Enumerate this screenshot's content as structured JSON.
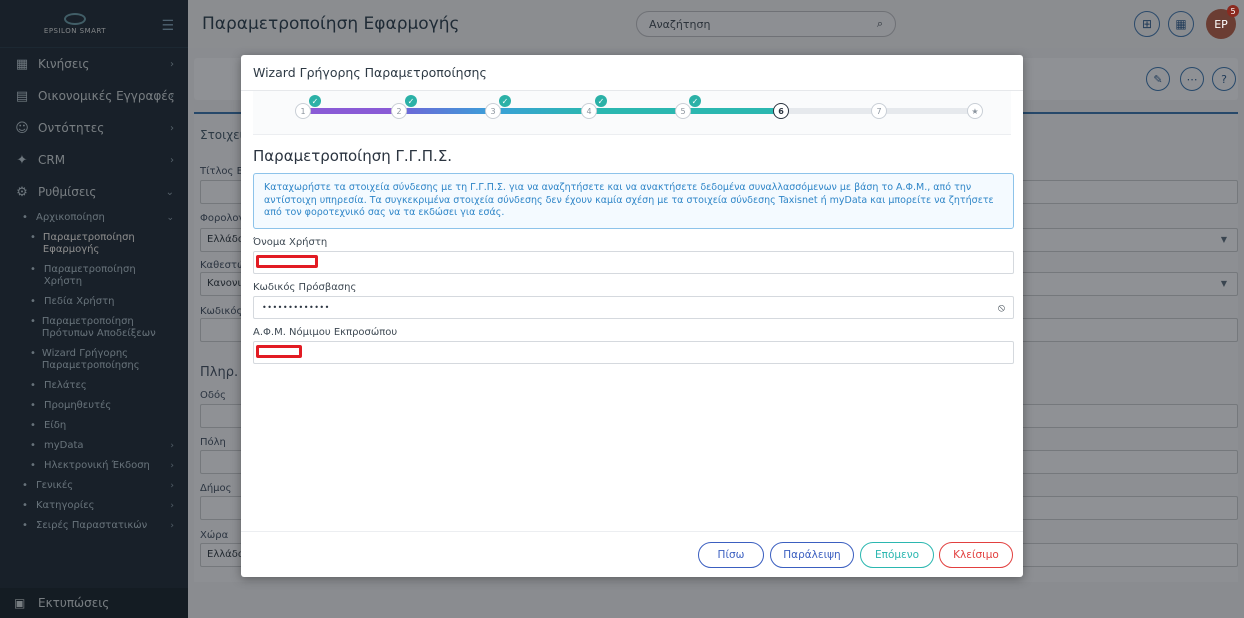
{
  "sidebar": {
    "logo_text": "EPSILON SMART",
    "items": [
      {
        "label": "Κινήσεις",
        "icon": "chart-icon"
      },
      {
        "label": "Οικονομικές Εγγραφές",
        "icon": "ledger-icon"
      },
      {
        "label": "Οντότητες",
        "icon": "people-icon"
      },
      {
        "label": "CRM",
        "icon": "crm-icon"
      },
      {
        "label": "Ρυθμίσεις",
        "icon": "gear-icon"
      }
    ],
    "sub_items": [
      {
        "label": "Αρχικοποίηση"
      },
      {
        "label": "Παραμετροποίηση Εφαρμογής"
      },
      {
        "label": "Παραμετροποίηση Χρήστη"
      },
      {
        "label": "Πεδία Χρήστη"
      },
      {
        "label": "Παραμετροποίηση Πρότυπων Αποδείξεων"
      },
      {
        "label": "Wizard Γρήγορης Παραμετροποίησης"
      },
      {
        "label": "Πελάτες"
      },
      {
        "label": "Προμηθευτές"
      },
      {
        "label": "Είδη"
      },
      {
        "label": "myData"
      },
      {
        "label": "Ηλεκτρονική Έκδοση"
      },
      {
        "label": "Γενικές"
      },
      {
        "label": "Κατηγορίες"
      },
      {
        "label": "Σειρές Παραστατικών"
      }
    ],
    "bottom_item": "Εκτυπώσεις"
  },
  "header": {
    "title": "Παραμετροποίηση Εφαρμογής",
    "search_placeholder": "Αναζήτηση",
    "avatar_initials": "EP",
    "notification_count": "5"
  },
  "background": {
    "tab_label": "Στοιχεία",
    "fields": [
      {
        "label": "Τίτλος Ετ",
        "value": ""
      },
      {
        "label": "Φορολογ",
        "value": "Ελλάδα"
      },
      {
        "label": "Καθεστώ",
        "value": "Κανονικ"
      },
      {
        "label": "Κωδικός",
        "value": ""
      }
    ],
    "section_title": "Πληρ. Δ",
    "address_fields": [
      {
        "label": "Οδός",
        "value": ""
      },
      {
        "label": "Πόλη",
        "value": ""
      },
      {
        "label": "Δήμος",
        "value": ""
      },
      {
        "label": "Χώρα",
        "value": "Ελλάδα"
      }
    ]
  },
  "modal": {
    "title": "Wizard Γρήγορης Παραμετροποίησης",
    "steps": [
      {
        "number": "1",
        "done": true,
        "color": "#8a5bd6"
      },
      {
        "number": "2",
        "done": true,
        "color": "#6a6fd9"
      },
      {
        "number": "3",
        "done": true,
        "color": "#3aa5d4"
      },
      {
        "number": "4",
        "done": true,
        "color": "#2bb7b0"
      },
      {
        "number": "5",
        "done": true,
        "color": "#2bb7b0"
      },
      {
        "number": "6",
        "done": false,
        "current": true
      },
      {
        "number": "7",
        "done": false
      },
      {
        "number": "★",
        "done": false
      }
    ],
    "heading": "Παραμετροποίηση Γ.Γ.Π.Σ.",
    "info_text": "Καταχωρήστε τα στοιχεία σύνδεσης με τη Γ.Γ.Π.Σ. για να αναζητήσετε και να ανακτήσετε δεδομένα συναλλασσόμενων με βάση το Α.Φ.Μ., από την αντίστοιχη υπηρεσία. Τα συγκεκριμένα στοιχεία σύνδεσης δεν έχουν καμία σχέση με τα στοιχεία σύνδεσης Taxisnet ή myData και μπορείτε να ζητήσετε από τον φοροτεχνικό σας να τα εκδώσει για εσάς.",
    "username_label": "Όνομα Χρήστη",
    "password_label": "Κωδικός Πρόσβασης",
    "password_value": "•••••••••••••",
    "afm_label": "Α.Φ.Μ. Νόμιμου Εκπροσώπου",
    "buttons": {
      "back": "Πίσω",
      "skip": "Παράλειψη",
      "next": "Επόμενο",
      "close": "Κλείσιμο"
    },
    "colors": {
      "back": "#3b5fc0",
      "skip": "#3b5fc0",
      "next": "#2bb7b0",
      "close": "#e2403f"
    }
  }
}
